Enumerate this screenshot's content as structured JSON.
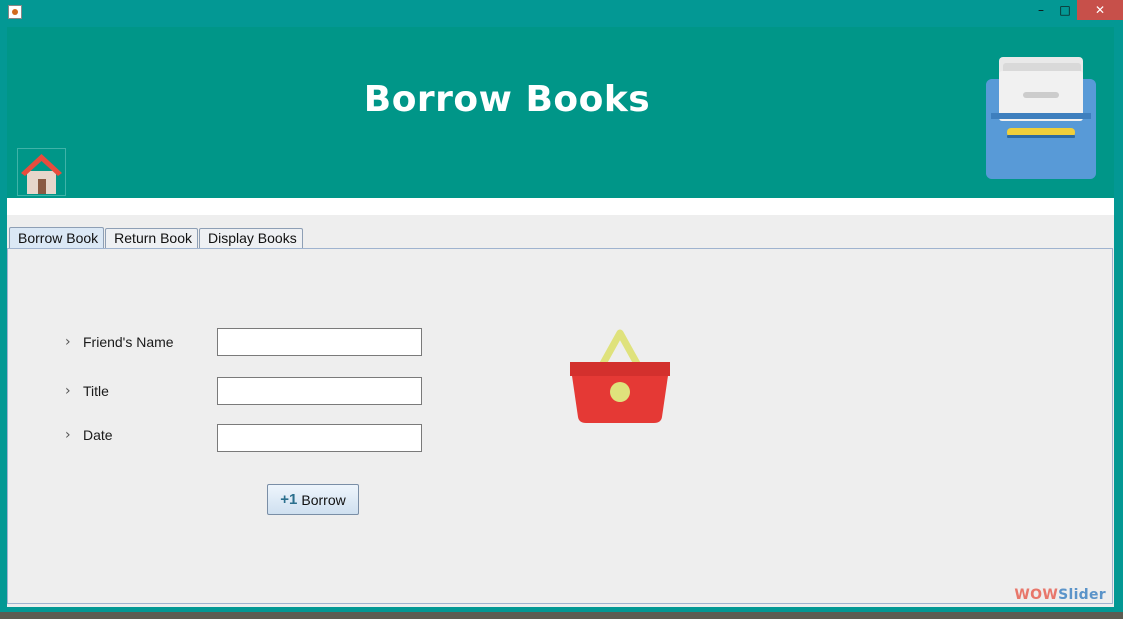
{
  "window": {
    "controls": {
      "minimize": "–",
      "maximize": "□",
      "close": "✕"
    }
  },
  "header": {
    "title": "Borrow Books",
    "home_icon": "home-icon",
    "cabinet_icon": "file-cabinet-icon",
    "colors": {
      "header_bg": "#009688",
      "window_frame": "#039894"
    }
  },
  "tabs": [
    {
      "label": "Borrow Book",
      "active": true
    },
    {
      "label": "Return Book",
      "active": false
    },
    {
      "label": "Display Books",
      "active": false
    }
  ],
  "form": {
    "fields": [
      {
        "label": "Friend's Name",
        "value": ""
      },
      {
        "label": "Title",
        "value": ""
      },
      {
        "label": "Date",
        "value": ""
      }
    ],
    "borrow_button": {
      "prefix": "+1",
      "label": "Borrow"
    },
    "basket_icon": "shopping-basket-icon"
  },
  "watermark": {
    "part1": "WOW",
    "part2": "Slider",
    "color1": "#e8776b",
    "color2": "#5b94c9"
  }
}
